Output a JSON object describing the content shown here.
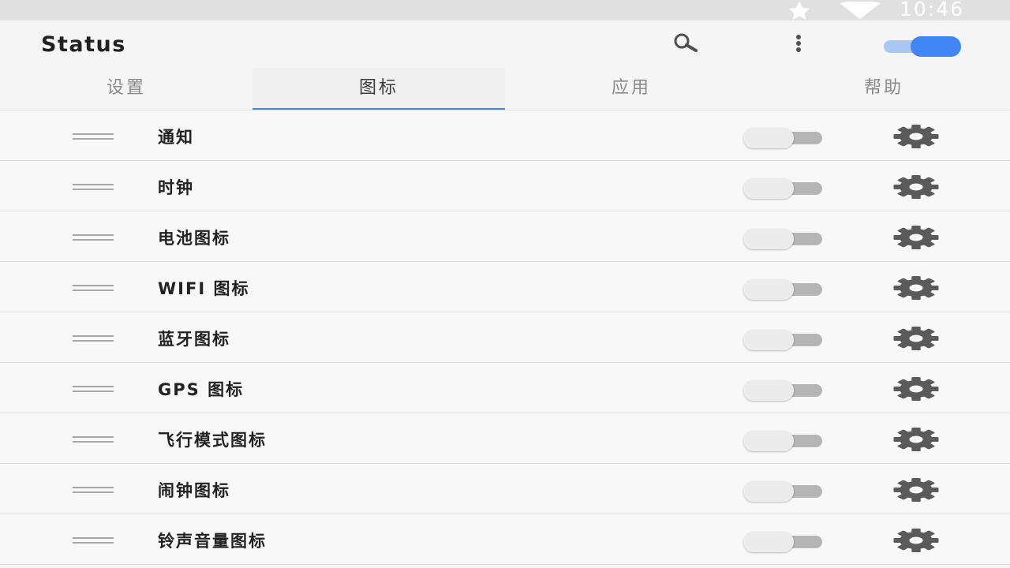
{
  "status_bar": {
    "time": "10:46",
    "icons": [
      "star-icon",
      "wifi-icon"
    ]
  },
  "app_bar": {
    "title": "Status",
    "icons": [
      "search-icon",
      "more-vert-icon"
    ],
    "master_toggle_on": true,
    "accent_color": "#4285f4"
  },
  "tabs": [
    {
      "label": "设置",
      "active": false
    },
    {
      "label": "图标",
      "active": true
    },
    {
      "label": "应用",
      "active": false
    },
    {
      "label": "帮助",
      "active": false
    }
  ],
  "items": [
    {
      "label": "通知",
      "enabled": false
    },
    {
      "label": "时钟",
      "enabled": false
    },
    {
      "label": "电池图标",
      "enabled": false
    },
    {
      "label": "WIFI 图标",
      "enabled": false
    },
    {
      "label": "蓝牙图标",
      "enabled": false
    },
    {
      "label": "GPS 图标",
      "enabled": false
    },
    {
      "label": "飞行模式图标",
      "enabled": false
    },
    {
      "label": "闹钟图标",
      "enabled": false
    },
    {
      "label": "铃声音量图标",
      "enabled": false
    }
  ],
  "row_icons": [
    "drag-handle-icon",
    "gear-icon"
  ]
}
